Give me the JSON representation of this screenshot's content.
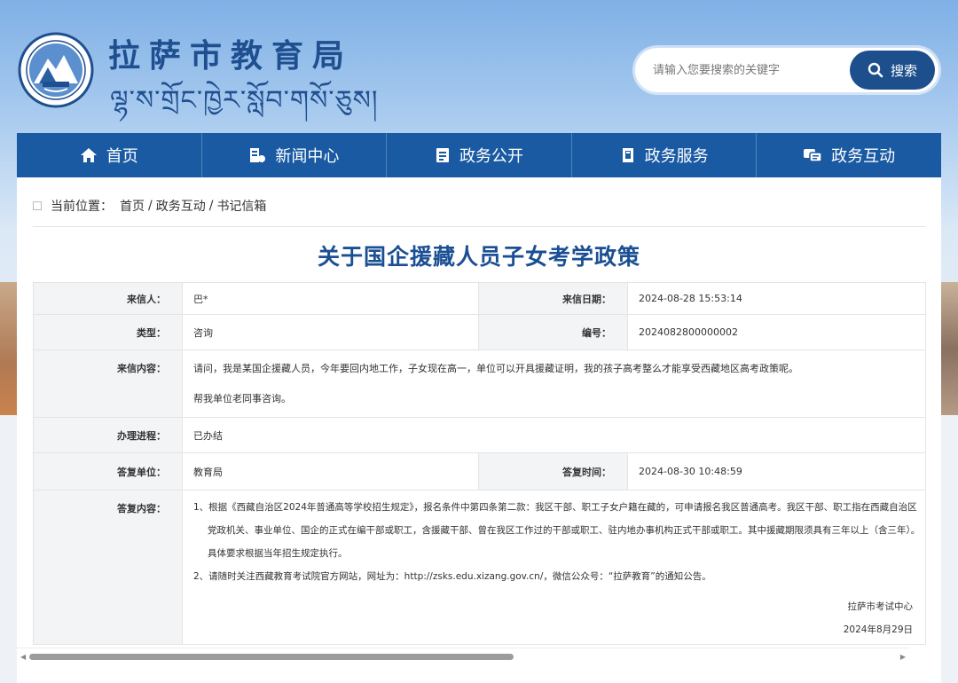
{
  "header": {
    "site_title": "拉萨市教育局",
    "site_subtitle": "ལྷ་ས་གྲོང་ཁྱེར་སློབ་གསོ་ཅུས།",
    "logo_icon": "emblem-icon"
  },
  "search": {
    "placeholder": "请输入您要搜索的关键字",
    "button_label": "搜索",
    "icon": "search-icon"
  },
  "nav": {
    "items": [
      {
        "label": "首页",
        "icon": "home-icon"
      },
      {
        "label": "新闻中心",
        "icon": "news-icon"
      },
      {
        "label": "政务公开",
        "icon": "document-icon"
      },
      {
        "label": "政务服务",
        "icon": "service-icon"
      },
      {
        "label": "政务互动",
        "icon": "chat-icon"
      }
    ]
  },
  "breadcrumb": {
    "prefix": "当前位置：",
    "items": [
      "首页",
      "政务互动",
      "书记信箱"
    ],
    "separator": "/"
  },
  "article": {
    "title": "关于国企援藏人员子女考学政策"
  },
  "letter": {
    "sender_label": "来信人：",
    "sender": "巴*",
    "date_label": "来信日期：",
    "date": "2024-08-28 15:53:14",
    "type_label": "类型：",
    "type": "咨询",
    "number_label": "编号：",
    "number": "2024082800000002",
    "content_label": "来信内容：",
    "content_p1": "请问，我是某国企援藏人员，今年要回内地工作，子女现在高一，单位可以开具援藏证明，我的孩子高考整么才能享受西藏地区高考政策呢。",
    "content_p2": "帮我单位老同事咨询。",
    "progress_label": "办理进程：",
    "progress": "已办结",
    "reply_unit_label": "答复单位：",
    "reply_unit": "教育局",
    "reply_time_label": "答复时间：",
    "reply_time": "2024-08-30 10:48:59",
    "reply_label": "答复内容：",
    "reply_l1": "1、根据《西藏自治区2024年普通高等学校招生规定》，报名条件中第四条第二款：我区干部、职工子女户籍在藏的，可申请报名我区普通高考。我区干部、职工指在西藏自治区",
    "reply_l2": "党政机关、事业单位、国企的正式在编干部或职工，含援藏干部、曾在我区工作过的干部或职工、驻内地办事机构正式干部或职工。其中援藏期限须具有三年以上（含三年）。",
    "reply_l3": "具体要求根据当年招生规定执行。",
    "reply_l4": "2、请随时关注西藏教育考试院官方网站，网址为：http://zsks.edu.xizang.gov.cn/，微信公众号：“拉萨教育”的通知公告。",
    "reply_sign": "拉萨市考试中心",
    "reply_sign_date": "2024年8月29日"
  },
  "colors": {
    "primary": "#1a5aa3",
    "title": "#1b4f93",
    "search_button": "#1d4f8c"
  }
}
